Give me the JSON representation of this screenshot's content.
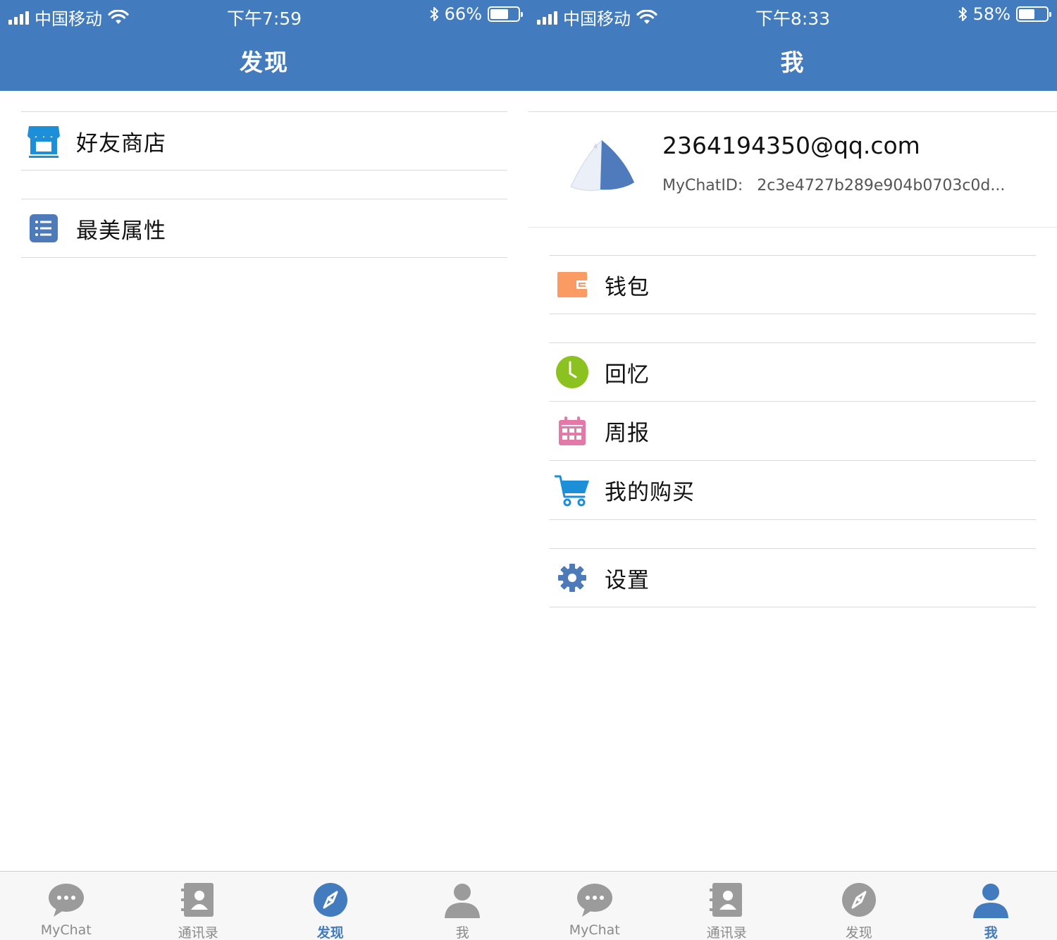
{
  "colors": {
    "brand": "#427bbe",
    "tab_inactive": "#9b9b9b",
    "wallet": "#f99b63",
    "memory": "#8cc21f",
    "weekly": "#e479a9",
    "cart": "#1d8fd8",
    "store": "#1d8fd8"
  },
  "screens": [
    {
      "status": {
        "carrier": "中国移动",
        "time": "下午7:59",
        "battery": "66%",
        "battery_level": 0.66
      },
      "title": "发现",
      "rows": [
        {
          "label": "好友商店",
          "icon": "store-icon"
        },
        {
          "label": "最美属性",
          "icon": "list-icon"
        }
      ],
      "tabs": [
        {
          "label": "MyChat",
          "icon": "chat-bubble-icon"
        },
        {
          "label": "通讯录",
          "icon": "contacts-icon"
        },
        {
          "label": "发现",
          "icon": "compass-icon"
        },
        {
          "label": "我",
          "icon": "person-icon"
        }
      ],
      "active_tab": 2
    },
    {
      "status": {
        "carrier": "中国移动",
        "time": "下午8:33",
        "battery": "58%",
        "battery_level": 0.58
      },
      "title": "我",
      "profile": {
        "email": "2364194350@qq.com",
        "id_label": "MyChatID:",
        "id_value": "2c3e4727b289e904b0703c0d..."
      },
      "rows": [
        {
          "label": "钱包",
          "icon": "wallet-icon"
        },
        {
          "label": "回忆",
          "icon": "clock-icon"
        },
        {
          "label": "周报",
          "icon": "calendar-icon"
        },
        {
          "label": "我的购买",
          "icon": "cart-icon"
        },
        {
          "label": "设置",
          "icon": "gear-icon"
        }
      ],
      "tabs": [
        {
          "label": "MyChat",
          "icon": "chat-bubble-icon"
        },
        {
          "label": "通讯录",
          "icon": "contacts-icon"
        },
        {
          "label": "发现",
          "icon": "compass-icon"
        },
        {
          "label": "我",
          "icon": "person-icon"
        }
      ],
      "active_tab": 3
    }
  ]
}
